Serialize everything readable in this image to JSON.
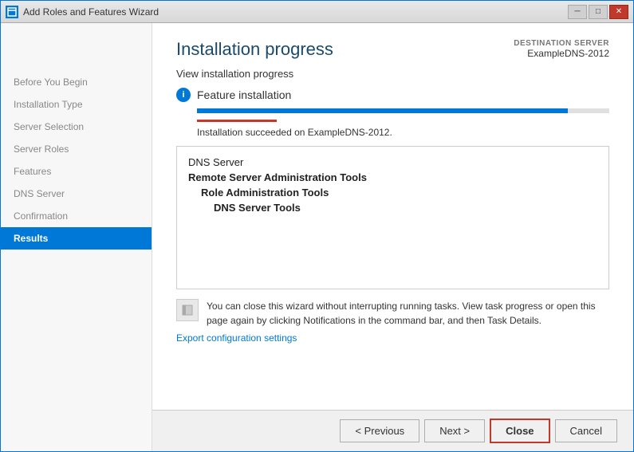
{
  "window": {
    "title": "Add Roles and Features Wizard",
    "icon": "📋"
  },
  "title_buttons": {
    "minimize": "─",
    "maximize": "□",
    "close": "✕"
  },
  "sidebar": {
    "items": [
      {
        "label": "Before You Begin",
        "active": false
      },
      {
        "label": "Installation Type",
        "active": false
      },
      {
        "label": "Server Selection",
        "active": false
      },
      {
        "label": "Server Roles",
        "active": false
      },
      {
        "label": "Features",
        "active": false
      },
      {
        "label": "DNS Server",
        "active": false
      },
      {
        "label": "Confirmation",
        "active": false
      },
      {
        "label": "Results",
        "active": true
      }
    ]
  },
  "header": {
    "page_title": "Installation progress",
    "destination_label": "DESTINATION SERVER",
    "destination_name": "ExampleDNS-2012"
  },
  "main": {
    "view_progress_label": "View installation progress",
    "feature_installation_label": "Feature installation",
    "info_icon": "i",
    "progress_percent": 90,
    "success_message": "Installation succeeded on ExampleDNS-2012.",
    "installed_features": [
      {
        "label": "DNS Server",
        "indent": 0,
        "bold": false
      },
      {
        "label": "Remote Server Administration Tools",
        "indent": 0,
        "bold": true
      },
      {
        "label": "Role Administration Tools",
        "indent": 1,
        "bold": true
      },
      {
        "label": "DNS Server Tools",
        "indent": 2,
        "bold": true
      }
    ],
    "notification_text": "You can close this wizard without interrupting running tasks. View task progress or open this page again by clicking Notifications in the command bar, and then Task Details.",
    "export_link": "Export configuration settings"
  },
  "footer": {
    "previous_label": "< Previous",
    "next_label": "Next >",
    "close_label": "Close",
    "cancel_label": "Cancel"
  }
}
